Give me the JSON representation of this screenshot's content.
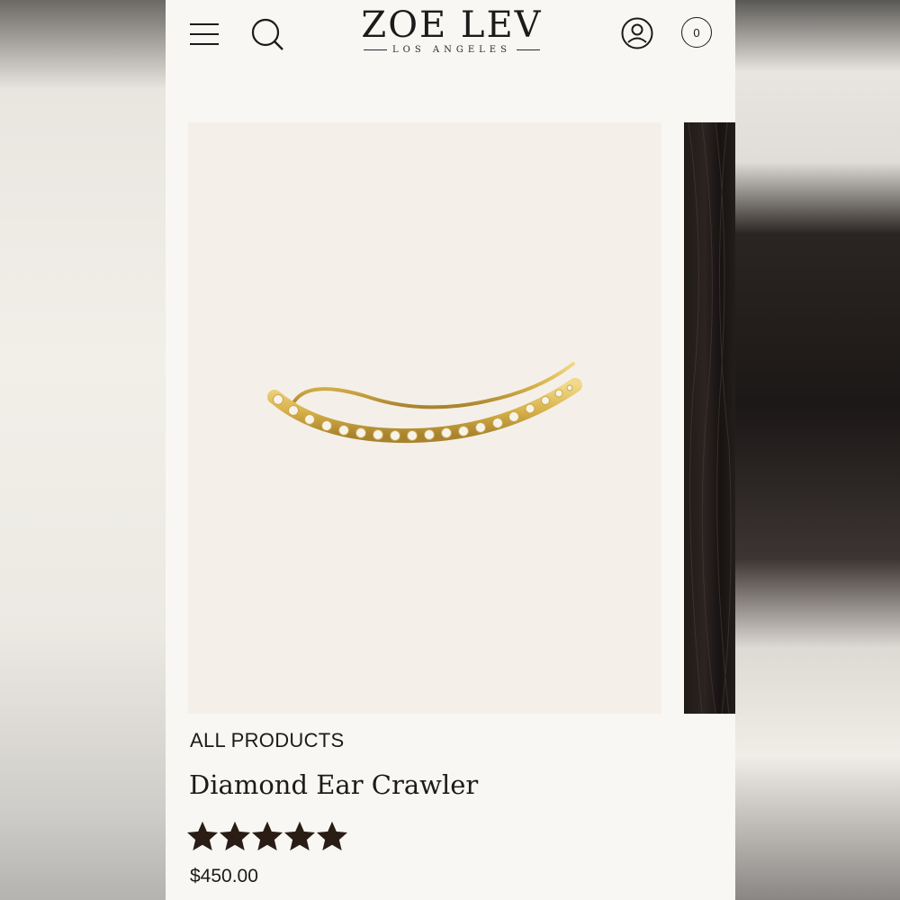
{
  "header": {
    "logo_main": "ZOE LEV",
    "logo_sub": "LOS ANGELES",
    "cart_count": "0",
    "icons": [
      "menu-icon",
      "search-icon",
      "account-icon",
      "cart-icon"
    ]
  },
  "product": {
    "breadcrumb": "ALL PRODUCTS",
    "title": "Diamond Ear Crawler",
    "rating": 5,
    "rating_max": 5,
    "price": "$450.00"
  },
  "colors": {
    "text": "#1b1b1b",
    "star": "#2a1d16",
    "image_bg": "#f4f0e9",
    "gold": "#d9b24a"
  }
}
